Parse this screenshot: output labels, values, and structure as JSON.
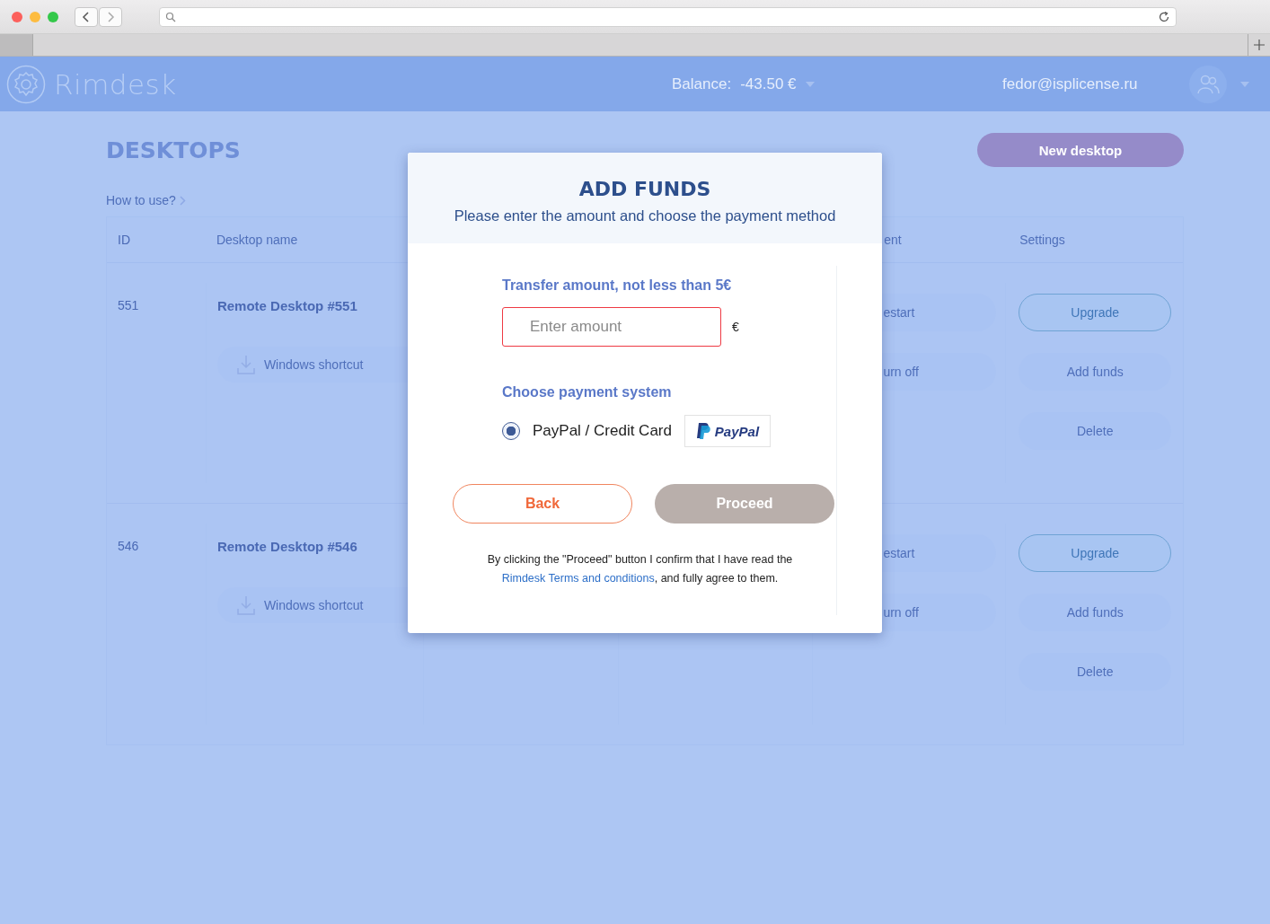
{
  "header": {
    "logo": "Rimdesk",
    "balance_label": "Balance:",
    "balance": "-43.50 €",
    "email": "fedor@isplicense.ru"
  },
  "page": {
    "title": "DESKTOPS",
    "help_link": "How to use?",
    "new_button": "New desktop"
  },
  "table": {
    "columns": [
      "ID",
      "Desktop name",
      "ent",
      "Settings"
    ],
    "rows": [
      {
        "id": "551",
        "name": "Remote Desktop #551",
        "shortcut": "Windows shortcut",
        "actions": [
          "estart",
          "urn off"
        ],
        "settings": [
          {
            "label": "Upgrade",
            "kind": "outline"
          },
          {
            "label": "Add funds",
            "kind": "soft"
          },
          {
            "label": "Delete",
            "kind": "soft"
          }
        ]
      },
      {
        "id": "546",
        "name": "Remote Desktop #546",
        "shortcut": "Windows shortcut",
        "actions": [
          "estart",
          "urn off"
        ],
        "settings": [
          {
            "label": "Upgrade",
            "kind": "outline"
          },
          {
            "label": "Add funds",
            "kind": "soft"
          },
          {
            "label": "Delete",
            "kind": "soft"
          }
        ]
      }
    ]
  },
  "modal": {
    "title": "ADD FUNDS",
    "subtitle": "Please enter the amount and choose the payment method",
    "amount_label": "Transfer amount, not less than 5€",
    "amount_placeholder": "Enter amount",
    "amount_invalid": true,
    "currency": "€",
    "payment_label": "Choose payment system",
    "payment_options": [
      {
        "label": "PayPal / Credit Card",
        "logo": "PayPal",
        "selected": true
      }
    ],
    "back_button": "Back",
    "proceed_button": "Proceed",
    "proceed_disabled": true,
    "consent_before": "By clicking the \"Proceed\" button I confirm that I have read the ",
    "consent_link": "Rimdesk Terms and conditions",
    "consent_after": ", and fully agree to them."
  }
}
